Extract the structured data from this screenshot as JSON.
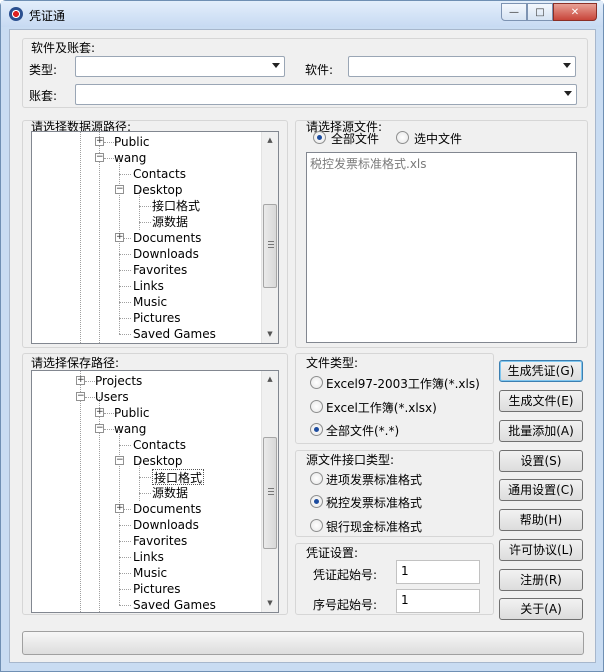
{
  "window": {
    "title": "凭证通"
  },
  "caption": {
    "minimize": "—",
    "maximize": "□",
    "close": "✕"
  },
  "top_group": {
    "title": "软件及账套:",
    "type_label": "类型:",
    "software_label": "软件:",
    "account_label": "账套:",
    "type_value": "",
    "software_value": "",
    "account_value": ""
  },
  "source_path": {
    "title": "请选择数据源路径:",
    "tree": [
      "Public",
      "wang",
      "Contacts",
      "Desktop",
      "接口格式",
      "源数据",
      "Documents",
      "Downloads",
      "Favorites",
      "Links",
      "Music",
      "Pictures",
      "Saved Games"
    ]
  },
  "save_path": {
    "title": "请选择保存路径:",
    "tree": [
      "Projects",
      "Users",
      "Public",
      "wang",
      "Contacts",
      "Desktop",
      "接口格式",
      "源数据",
      "Documents",
      "Downloads",
      "Favorites",
      "Links",
      "Music",
      "Pictures",
      "Saved Games"
    ]
  },
  "source_files": {
    "title": "请选择源文件:",
    "opt_all": "全部文件",
    "opt_selected": "选中文件",
    "selected_option": "全部文件",
    "files": [
      "税控发票标准格式.xls"
    ]
  },
  "file_type": {
    "title": "文件类型:",
    "options": [
      "Excel97-2003工作簿(*.xls)",
      "Excel工作簿(*.xlsx)",
      "全部文件(*.*)"
    ],
    "selected": "全部文件(*.*)"
  },
  "interface_type": {
    "title": "源文件接口类型:",
    "options": [
      "进项发票标准格式",
      "税控发票标准格式",
      "银行现金标准格式"
    ],
    "selected": "税控发票标准格式"
  },
  "voucher_settings": {
    "title": "凭证设置:",
    "start_label": "凭证起始号:",
    "start_value": "1",
    "seq_label": "序号起始号:",
    "seq_value": "1"
  },
  "buttons": {
    "generate_voucher": "生成凭证(G)",
    "generate_file": "生成文件(E)",
    "batch_add": "批量添加(A)",
    "settings": "设置(S)",
    "general_settings": "通用设置(C)",
    "help": "帮助(H)",
    "license": "许可协议(L)",
    "register": "注册(R)",
    "about": "关于(A)"
  },
  "status_bar": {
    "text": ""
  }
}
